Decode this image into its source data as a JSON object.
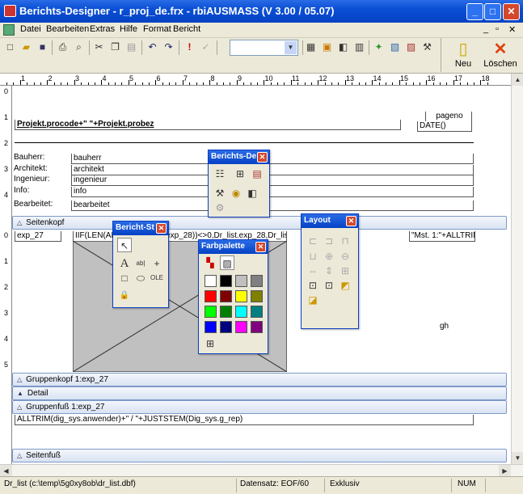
{
  "window": {
    "title": "Berichts-Designer - r_proj_de.frx - rbiAUSMASS (V 3.00 / 05.07)",
    "min": "_",
    "max": "□",
    "close": "✕"
  },
  "menu": [
    "Datei",
    "Bearbeiten",
    "Extras",
    "Hilfe",
    "Format",
    "Bericht"
  ],
  "toolbar": {
    "neu_label": "Neu",
    "loeschen_label": "Löschen",
    "font_value": ""
  },
  "ruler": [
    "1",
    "2",
    "3",
    "4",
    "5",
    "6",
    "7",
    "8",
    "9",
    "10",
    "11",
    "12",
    "13",
    "14",
    "15",
    "16",
    "17",
    "18"
  ],
  "vruler_page": [
    "0",
    "1",
    "2",
    "3",
    "4"
  ],
  "vruler_group": [
    "0",
    "1",
    "2",
    "3",
    "4",
    "5"
  ],
  "page_header": {
    "pageno": "pageno",
    "date": "DATE()",
    "procode": "Projekt.procode+\" \"+Projekt.probez",
    "labels": [
      "Bauherr:",
      "Architekt:",
      "Ingenieur:",
      "Info:",
      "Bearbeitet:"
    ],
    "fields": [
      "bauherr",
      "architekt",
      "ingenieur",
      "info",
      "bearbeitet"
    ]
  },
  "bands": {
    "seitenkopf": "Seitenkopf",
    "gruppenkopf": "Gruppenkopf 1:exp_27",
    "detail": "Detail",
    "gruppenfuss": "Gruppenfuß 1:exp_27",
    "seitenfuss": "Seitenfuß"
  },
  "group": {
    "exp": "exp_27",
    "iif": "IIF(LEN(ALLTRIM(dr_list.exp_28))<>0,Dr_list.exp_28,Dr_list.info)",
    "mst": "\"Mst. 1:\"+ALLTRIM(",
    "gh": "gh"
  },
  "footer_field": "ALLTRIM(dig_sys.anwender)+\" / \"+JUSTSTEM(Dig_sys.g_rep)",
  "panels": {
    "berichts_de": "Berichts-De",
    "bericht_st": "Bericht-St",
    "farbpalette": "Farbpalette",
    "layout": "Layout"
  },
  "palette_colors": [
    "#ffffff",
    "#000000",
    "#c0c0c0",
    "#808080",
    "#ff0000",
    "#800000",
    "#ffff00",
    "#808000",
    "#00ff00",
    "#008000",
    "#00ffff",
    "#008080",
    "#0000ff",
    "#000080",
    "#ff00ff",
    "#800080"
  ],
  "status": {
    "path": "Dr_list (c:\\temp\\5g0xy8ob\\dr_list.dbf)",
    "record": "Datensatz: EOF/60",
    "mode": "Exklusiv",
    "num": "NUM"
  }
}
